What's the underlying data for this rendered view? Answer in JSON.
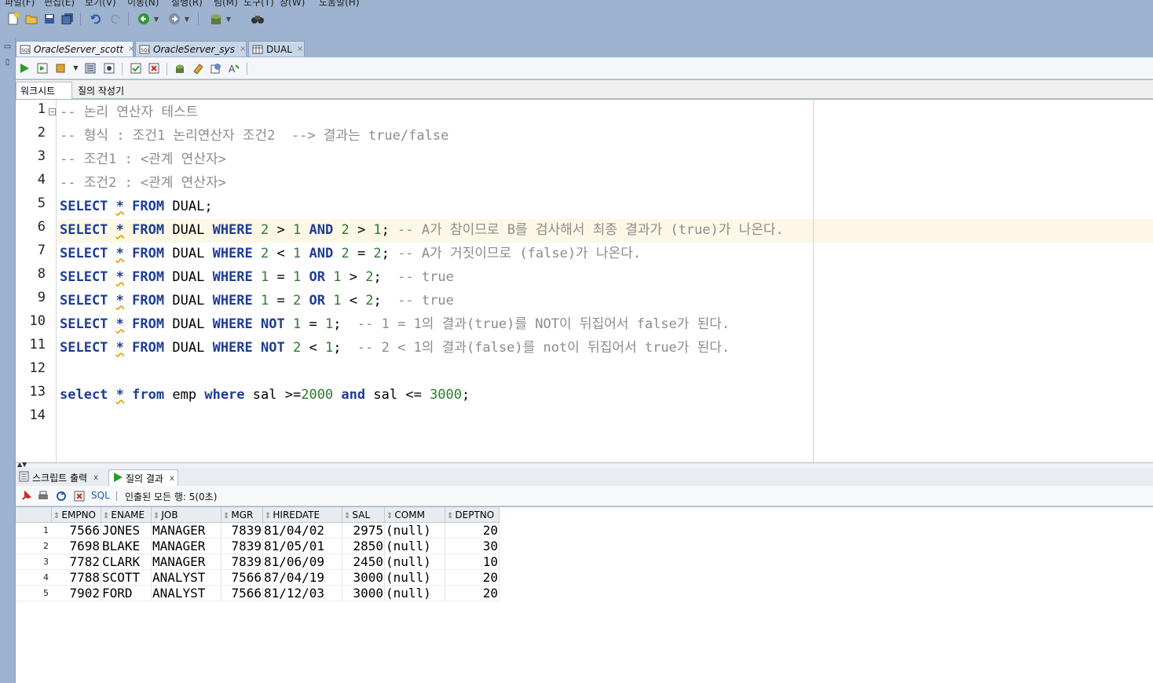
{
  "menu": [
    "파일(F)",
    "편집(E)",
    "보기(V)",
    "이동(N)",
    "실행(R)",
    "팀(M)",
    "도구(T)",
    "창(W)",
    "도움말(H)"
  ],
  "tabs": [
    {
      "label": "OracleServer_scott",
      "icon": "sql-worksheet-icon"
    },
    {
      "label": "OracleServer_sys",
      "icon": "sql-worksheet-icon"
    },
    {
      "label": "DUAL",
      "icon": "table-icon"
    }
  ],
  "subtabs": {
    "worksheet": "워크시트",
    "query_builder": "질의 작성기"
  },
  "editor": {
    "line_numbers": [
      "1",
      "2",
      "3",
      "4",
      "5",
      "6",
      "7",
      "8",
      "9",
      "10",
      "11",
      "12",
      "13",
      "14"
    ]
  },
  "results": {
    "tabs": {
      "script_output": "스크립트 출력",
      "query_result": "질의 결과"
    },
    "sql_label": "SQL",
    "status": "인출된 모든 행: 5(0초)",
    "columns": [
      "EMPNO",
      "ENAME",
      "JOB",
      "MGR",
      "HIREDATE",
      "SAL",
      "COMM",
      "DEPTNO"
    ],
    "rows": [
      {
        "n": "1",
        "empno": "7566",
        "ename": "JONES",
        "job": "MANAGER",
        "mgr": "7839",
        "hiredate": "81/04/02",
        "sal": "2975",
        "comm": "(null)",
        "deptno": "20"
      },
      {
        "n": "2",
        "empno": "7698",
        "ename": "BLAKE",
        "job": "MANAGER",
        "mgr": "7839",
        "hiredate": "81/05/01",
        "sal": "2850",
        "comm": "(null)",
        "deptno": "30"
      },
      {
        "n": "3",
        "empno": "7782",
        "ename": "CLARK",
        "job": "MANAGER",
        "mgr": "7839",
        "hiredate": "81/06/09",
        "sal": "2450",
        "comm": "(null)",
        "deptno": "10"
      },
      {
        "n": "4",
        "empno": "7788",
        "ename": "SCOTT",
        "job": "ANALYST",
        "mgr": "7566",
        "hiredate": "87/04/19",
        "sal": "3000",
        "comm": "(null)",
        "deptno": "20"
      },
      {
        "n": "5",
        "empno": "7902",
        "ename": "FORD",
        "job": "ANALYST",
        "mgr": "7566",
        "hiredate": "81/12/03",
        "sal": "3000",
        "comm": "(null)",
        "deptno": "20"
      }
    ]
  },
  "code": {
    "l1": "-- 논리 연산자 테스트",
    "l2": "-- 형식 : 조건1 논리연산자 조건2  --> 결과는 true/false",
    "l3": "-- 조건1 : <관계 연산자>",
    "l4": "-- 조건2 : <관계 연산자>",
    "select": "SELECT",
    "from": "FROM",
    "where": "WHERE",
    "and": "AND",
    "or": "OR",
    "not": "NOT",
    "star": "*",
    "dual": "DUAL",
    "dual_semi": "DUAL;",
    "c6": "-- A가 참이므로 B를 검사해서 최종 결과가 (true)가 나온다.",
    "c7": "-- A가 거짓이므로 (false)가 나온다.",
    "c8": "-- true",
    "c9": "-- true",
    "c10": "-- 1 = 1의 결과(true)를 NOT이 뒤집어서 false가 된다.",
    "c11": "-- 2 < 1의 결과(false)를 not이 뒤집어서 true가 된다.",
    "select_l": "select",
    "from_l": "from",
    "where_l": "where",
    "and_l": "and",
    "emp": "emp",
    "sal": "sal",
    "n2000": "2000",
    "n3000": "3000"
  }
}
